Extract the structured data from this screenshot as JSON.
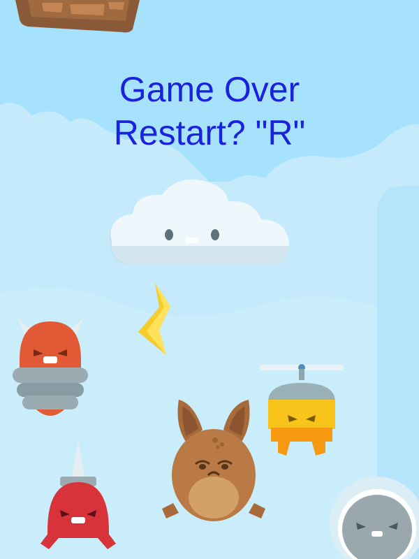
{
  "overlay": {
    "title": "Game Over",
    "prompt": "Restart? \"R\""
  },
  "colors": {
    "sky": "#a6e2fb",
    "text": "#1a22e0",
    "player": "#b97a45",
    "red_monster": "#e25a35",
    "drill_monster": "#d8333a",
    "propeller_monster": "#f8c31a",
    "platform": "#8a5a38",
    "lightning": "#f5cc2b"
  },
  "sprites": [
    {
      "name": "broken-brown-platform",
      "kind": "platform"
    },
    {
      "name": "storm-cloud-enemy",
      "kind": "enemy"
    },
    {
      "name": "lightning-bolt",
      "kind": "hazard"
    },
    {
      "name": "horned-red-monster",
      "kind": "enemy"
    },
    {
      "name": "propeller-hat-monster",
      "kind": "enemy"
    },
    {
      "name": "doodle-creature-player",
      "kind": "player"
    },
    {
      "name": "drill-red-monster",
      "kind": "enemy"
    },
    {
      "name": "spiky-gray-monster",
      "kind": "enemy"
    }
  ]
}
